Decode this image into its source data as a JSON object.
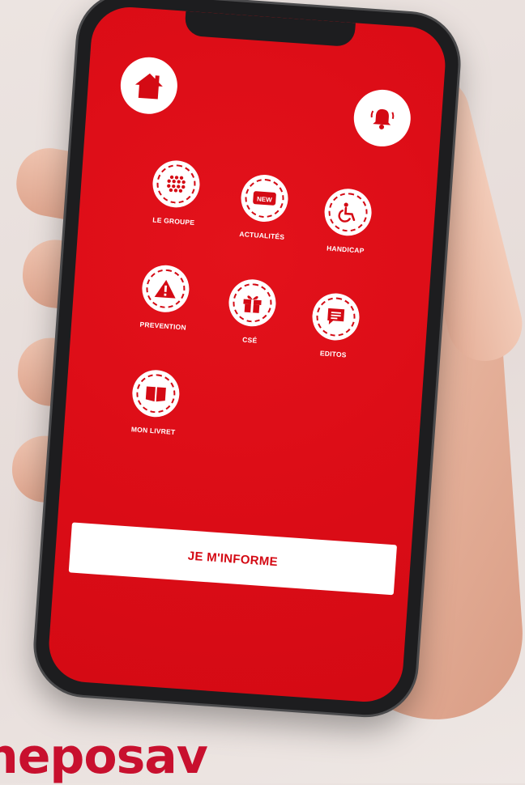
{
  "screen": {
    "menu": [
      {
        "label": "LE GROUPE",
        "icon": "grid-dots-icon"
      },
      {
        "label": "ACTUALITÉS",
        "icon": "new-badge-icon",
        "badge": "NEW"
      },
      {
        "label": "HANDICAP",
        "icon": "accessibility-icon"
      },
      {
        "label": "PREVENTION",
        "icon": "warning-icon"
      },
      {
        "label": "CSÉ",
        "icon": "gift-icon"
      },
      {
        "label": "EDITOS",
        "icon": "message-icon"
      },
      {
        "label": "MON LIVRET",
        "icon": "book-icon"
      }
    ],
    "cta_label": "JE M'INFORME",
    "top_icons": {
      "left": "home-icon",
      "right": "alarm-bell-icon"
    }
  },
  "brand_text": "neposav",
  "colors": {
    "primary_red": "#d40a14",
    "brand_red": "#c8102e",
    "white": "#ffffff"
  }
}
